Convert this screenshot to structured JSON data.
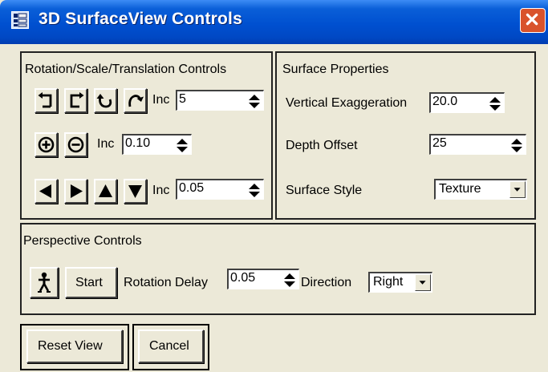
{
  "window": {
    "title": "3D SurfaceView Controls"
  },
  "rotation_group": {
    "title": "Rotation/Scale/Translation Controls",
    "rotate_inc_label": "Inc",
    "rotate_inc_value": "5",
    "scale_inc_label": "Inc",
    "scale_inc_value": "0.10",
    "translate_inc_label": "Inc",
    "translate_inc_value": "0.05"
  },
  "surface_group": {
    "title": "Surface Properties",
    "vertical_exaggeration_label": "Vertical Exaggeration",
    "vertical_exaggeration_value": "20.0",
    "depth_offset_label": "Depth Offset",
    "depth_offset_value": "25",
    "surface_style_label": "Surface Style",
    "surface_style_value": "Texture"
  },
  "perspective_group": {
    "title": "Perspective Controls",
    "start_label": "Start",
    "rotation_delay_label": "Rotation Delay",
    "rotation_delay_value": "0.05",
    "direction_label": "Direction",
    "direction_value": "Right"
  },
  "footer": {
    "reset_label": "Reset View",
    "cancel_label": "Cancel"
  },
  "icons": {
    "app": "app-grid-icon",
    "close": "close-x-icon",
    "rotate_cw": "rotate-clockwise-icon",
    "rotate_ccw": "rotate-counterclockwise-icon",
    "tilt_back": "tilt-back-icon",
    "tilt_forward": "tilt-forward-icon",
    "zoom_in": "zoom-in-icon",
    "zoom_out": "zoom-out-icon",
    "pan_left": "arrow-left-icon",
    "pan_right": "arrow-right-icon",
    "pan_up": "arrow-up-icon",
    "pan_down": "arrow-down-icon",
    "walk": "walking-person-icon"
  },
  "colors": {
    "title_bar": "#0054e3",
    "dialog_bg": "#ece9d8",
    "close_button": "#d9532c"
  }
}
